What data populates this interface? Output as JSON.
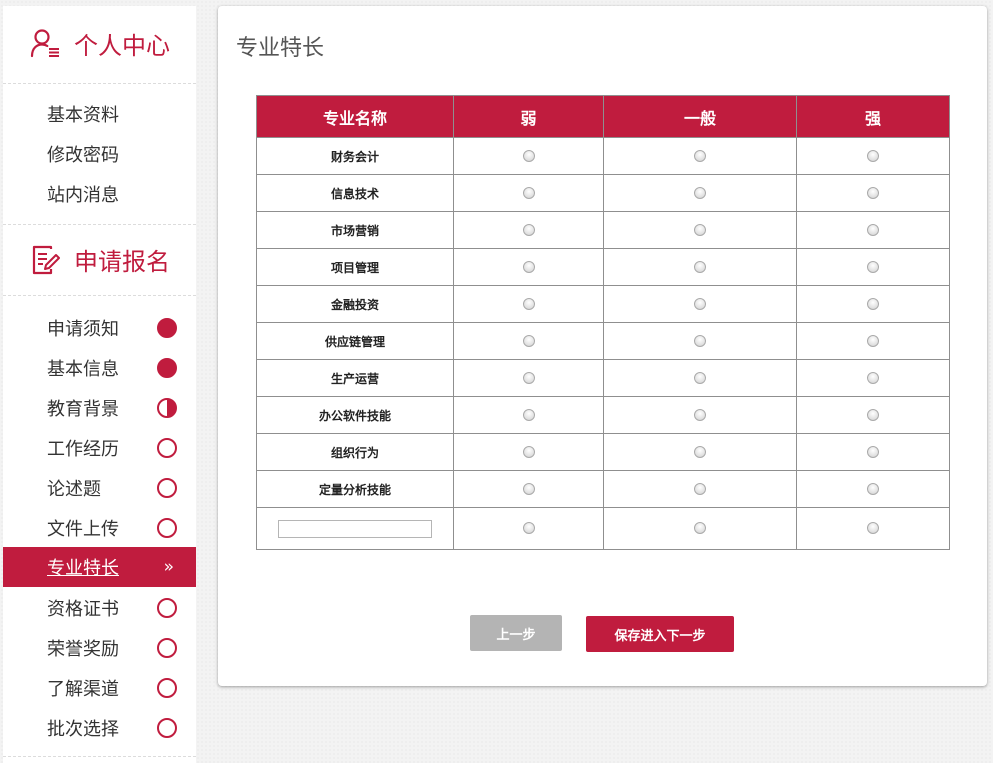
{
  "sidebar": {
    "profile_title": "个人中心",
    "profile_items": [
      {
        "label": "基本资料"
      },
      {
        "label": "修改密码"
      },
      {
        "label": "站内消息"
      }
    ],
    "apply_title": "申请报名",
    "steps": [
      {
        "label": "申请须知",
        "status": "complete"
      },
      {
        "label": "基本信息",
        "status": "complete"
      },
      {
        "label": "教育背景",
        "status": "partial"
      },
      {
        "label": "工作经历",
        "status": "empty"
      },
      {
        "label": "论述题",
        "status": "empty"
      },
      {
        "label": "文件上传",
        "status": "empty"
      },
      {
        "label": "专业特长",
        "status": "active",
        "arrow": "»"
      },
      {
        "label": "资格证书",
        "status": "empty"
      },
      {
        "label": "荣誉奖励",
        "status": "empty"
      },
      {
        "label": "了解渠道",
        "status": "empty"
      },
      {
        "label": "批次选择",
        "status": "empty"
      }
    ]
  },
  "main": {
    "title": "专业特长",
    "table": {
      "headers": [
        "专业名称",
        "弱",
        "一般",
        "强"
      ],
      "rows": [
        "财务会计",
        "信息技术",
        "市场营销",
        "项目管理",
        "金融投资",
        "供应链管理",
        "生产运营",
        "办公软件技能",
        "组织行为",
        "定量分析技能"
      ],
      "custom_row_value": ""
    },
    "buttons": {
      "prev": "上一步",
      "next": "保存进入下一步"
    }
  },
  "colors": {
    "accent": "#c01c3e",
    "prev_button": "#b4b4b4",
    "table_border": "#8f8f8f"
  }
}
